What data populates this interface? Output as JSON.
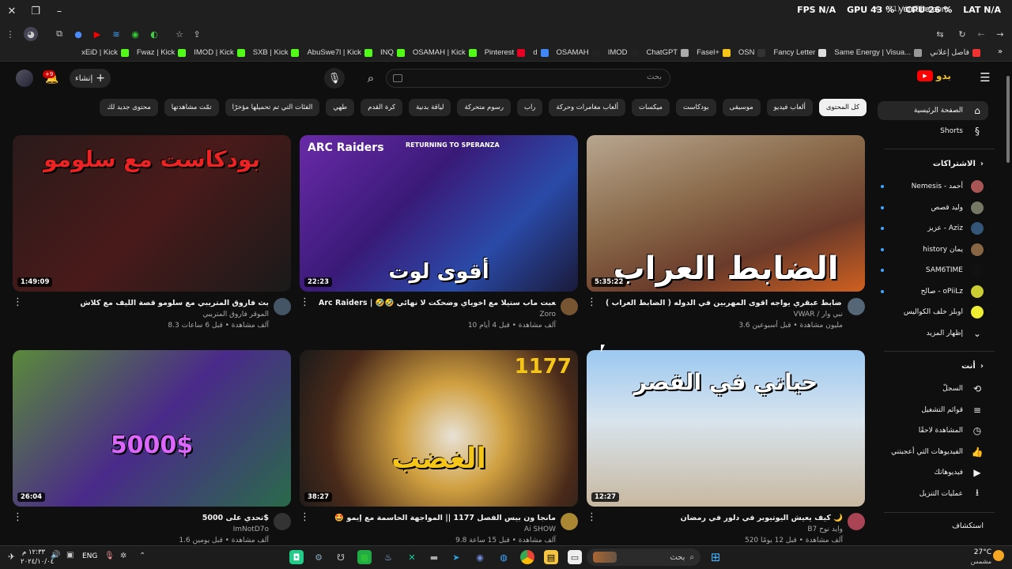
{
  "browser": {
    "overlay": {
      "fps_label": "FPS",
      "fps": "N/A",
      "gpu": "GPU 43 %",
      "cpu": "CPU 26 %",
      "lat_label": "LAT",
      "lat": "N/A",
      "tab_title": "(31) YouTube"
    },
    "url": "youtube.com",
    "bookmarks": [
      {
        "label": "فاصل إعلاني",
        "color": "#e33"
      },
      {
        "label": "Same Energy | Visua...",
        "color": "#999"
      },
      {
        "label": "Fancy Letter",
        "color": "#ddd"
      },
      {
        "label": "OSN",
        "color": "#333"
      },
      {
        "label": "Fasel+",
        "color": "#f5c518"
      },
      {
        "label": "ChatGPT",
        "color": "#aaa"
      },
      {
        "label": "IMOD",
        "color": "#222"
      },
      {
        "label": "OSAMAH",
        "color": "#222"
      },
      {
        "label": "d",
        "color": "#4285f4"
      },
      {
        "label": "Pinterest",
        "color": "#e60023"
      },
      {
        "label": "OSAMAH | Kick",
        "color": "#53fc18"
      },
      {
        "label": "INQ",
        "color": "#53fc18"
      },
      {
        "label": "AbuSwe7l | Kick",
        "color": "#53fc18"
      },
      {
        "label": "SXB | Kick",
        "color": "#53fc18"
      },
      {
        "label": "IMOD | Kick",
        "color": "#53fc18"
      },
      {
        "label": "Fwaz | Kick",
        "color": "#53fc18"
      },
      {
        "label": "xEiD | Kick",
        "color": "#53fc18"
      }
    ]
  },
  "header": {
    "search_placeholder": "بحث",
    "create_label": "إنشاء",
    "notif_count": "+9",
    "logo_text": "بدو"
  },
  "chips": [
    "كل المحتوى",
    "ألعاب فيديو",
    "موسيقى",
    "بودكاست",
    "ميكسات",
    "ألعاب مغامرات وحركة",
    "راب",
    "رسوم متحركة",
    "لياقة بدنية",
    "كرة القدم",
    "طهي",
    "الفئات التي تم تحميلها مؤخرًا",
    "تمّت مشاهدتها",
    "محتوى جديد لك"
  ],
  "sidebar": {
    "home": "الصفحة الرئيسية",
    "shorts": "Shorts",
    "subs_header": "الاشتراكات",
    "subs": [
      {
        "name": "Nemesis - أحمد",
        "color": "#a55",
        "dot": true
      },
      {
        "name": "وليد قصص",
        "color": "#776",
        "dot": true
      },
      {
        "name": "عزيز - Aziz",
        "color": "#357",
        "dot": true
      },
      {
        "name": "history يمان",
        "color": "#864",
        "dot": true
      },
      {
        "name": "SAM6TIME",
        "color": "#111",
        "dot": true
      },
      {
        "name": "صالح - oPiiLz",
        "color": "#cc3",
        "dot": true
      },
      {
        "name": "اوبلز خلف الكواليس",
        "color": "#ee3",
        "dot": false
      }
    ],
    "show_more": "إظهار المزيد",
    "you_header": "أنت",
    "you": [
      {
        "label": "السجلّ",
        "icon": "⟲"
      },
      {
        "label": "قوائم التشغيل",
        "icon": "≡"
      },
      {
        "label": "المشاهدة لاحقًا",
        "icon": "◷"
      },
      {
        "label": "الفيديوهات التي أعجبتني",
        "icon": "👍"
      },
      {
        "label": "فيديوهاتك",
        "icon": "▶"
      },
      {
        "label": "عمليات التنزيل",
        "icon": "⭳"
      }
    ],
    "explore_header": "استكشاف"
  },
  "videos": [
    {
      "title": "قصه ضابط عبقري يواجه اقوى المهربين في الدوله ( الضابط العراب ) !",
      "channel": "VWAR / نبي وار",
      "meta": "3.6 مليون مشاهدة • قبل أسبوعين",
      "duration": "5:35:22",
      "thumb_text": "الضابط العراب",
      "verified": true
    },
    {
      "title": "Arc Raiders | 🤣🤣 لعبت ماب ستيلا مع اخوياي وضحكت لا نهائي",
      "channel": "Zoro",
      "meta": "10 آلف مشاهدة • قبل 4 أيام",
      "duration": "22:23",
      "thumb_text": "أقوى لوت",
      "thumb_sub": "ARC Raiders",
      "thumb_sub2": "RETURNING TO SPERANZA"
    },
    {
      "title": "بث فاروق المتريبي مع سلومو قصة الليف مع كلاش",
      "channel": "الموقر فاروق المتريبي",
      "meta": "8.3 آلف مشاهدة • قبل 6 ساعات",
      "duration": "1:49:09",
      "thumb_text": "بودكاست مع سلومو"
    },
    {
      "title": "كيف يعيش اليوتيوبر في دلور في رمضان 🌙",
      "channel": "B7 وايد نوح",
      "meta": "520 آلف مشاهدة • قبل 12 يومًا",
      "duration": "12:27",
      "thumb_text": "حياتي في القصر"
    },
    {
      "title": "🤩 مانجا ون بيس الفصل 1177 || المواجهة الحاسمة مع إيمو",
      "channel": "Ai SHOW",
      "meta": "9.8 آلف مشاهدة • قبل 15 ساعة",
      "duration": "38:27",
      "thumb_text": "الغضب",
      "thumb_sub": "1177"
    },
    {
      "title": "تحدي على 5000$",
      "channel": "ImNotD7o",
      "meta": "1.6 آلف مشاهدة • قبل يومين",
      "duration": "26:04",
      "thumb_text": "5000$"
    }
  ],
  "taskbar": {
    "search_label": "بحث",
    "lang": "ENG",
    "time": "١٢:٣٣ م",
    "date": "٢٠٢٤/١٠/٠٤",
    "weather_temp": "27°C",
    "weather_label": "مشمس"
  }
}
